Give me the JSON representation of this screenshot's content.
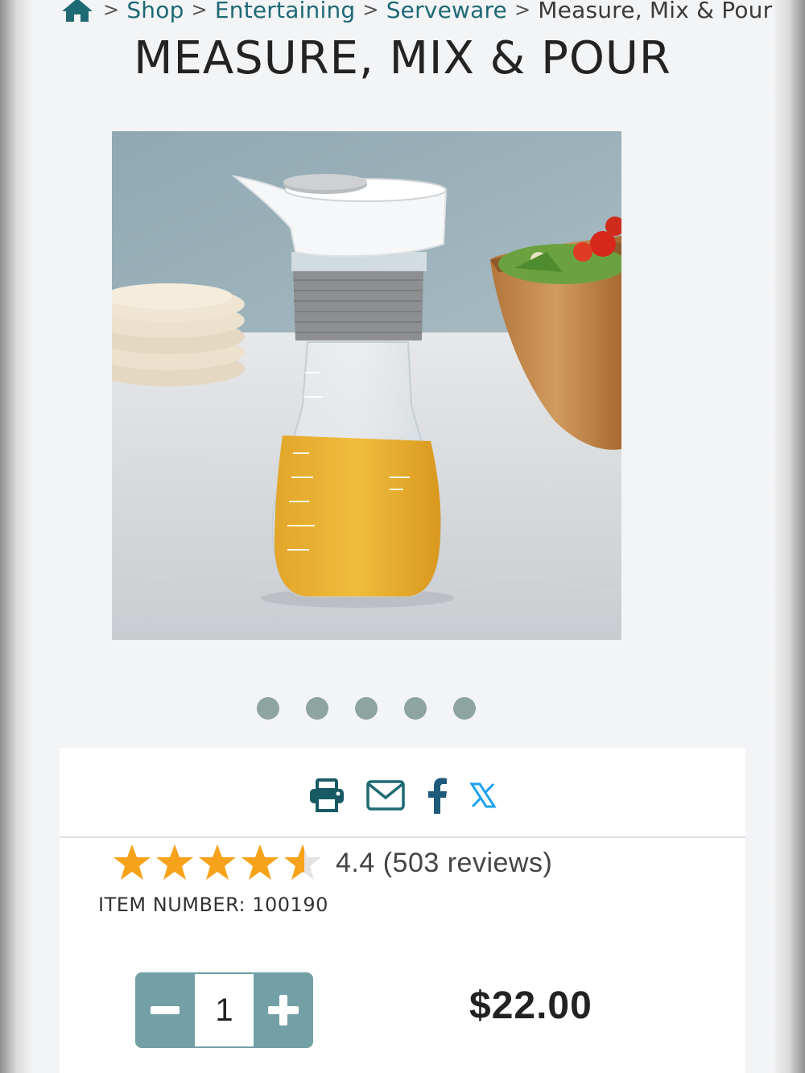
{
  "breadcrumb": {
    "items": [
      {
        "label": "Shop",
        "link": true
      },
      {
        "label": "Entertaining",
        "link": true
      },
      {
        "label": "Serveware",
        "link": true
      },
      {
        "label": "Measure, Mix & Pour",
        "link": false
      }
    ],
    "separator": ">"
  },
  "product": {
    "title": "MEASURE, MIX & POUR",
    "image_count": 5,
    "rating": 4.4,
    "rating_text": "4.4 (503 reviews)",
    "item_number": "ITEM NUMBER: 100190",
    "quantity": "1",
    "price": "$22.00"
  },
  "share": {
    "icons": [
      "print-icon",
      "email-icon",
      "facebook-icon",
      "x-icon"
    ]
  },
  "colors": {
    "accent": "#1e6a74",
    "stepper": "#72a0a6",
    "star": "#f7a21b",
    "dot": "#8da49f",
    "x_brand": "#1da1f2"
  }
}
